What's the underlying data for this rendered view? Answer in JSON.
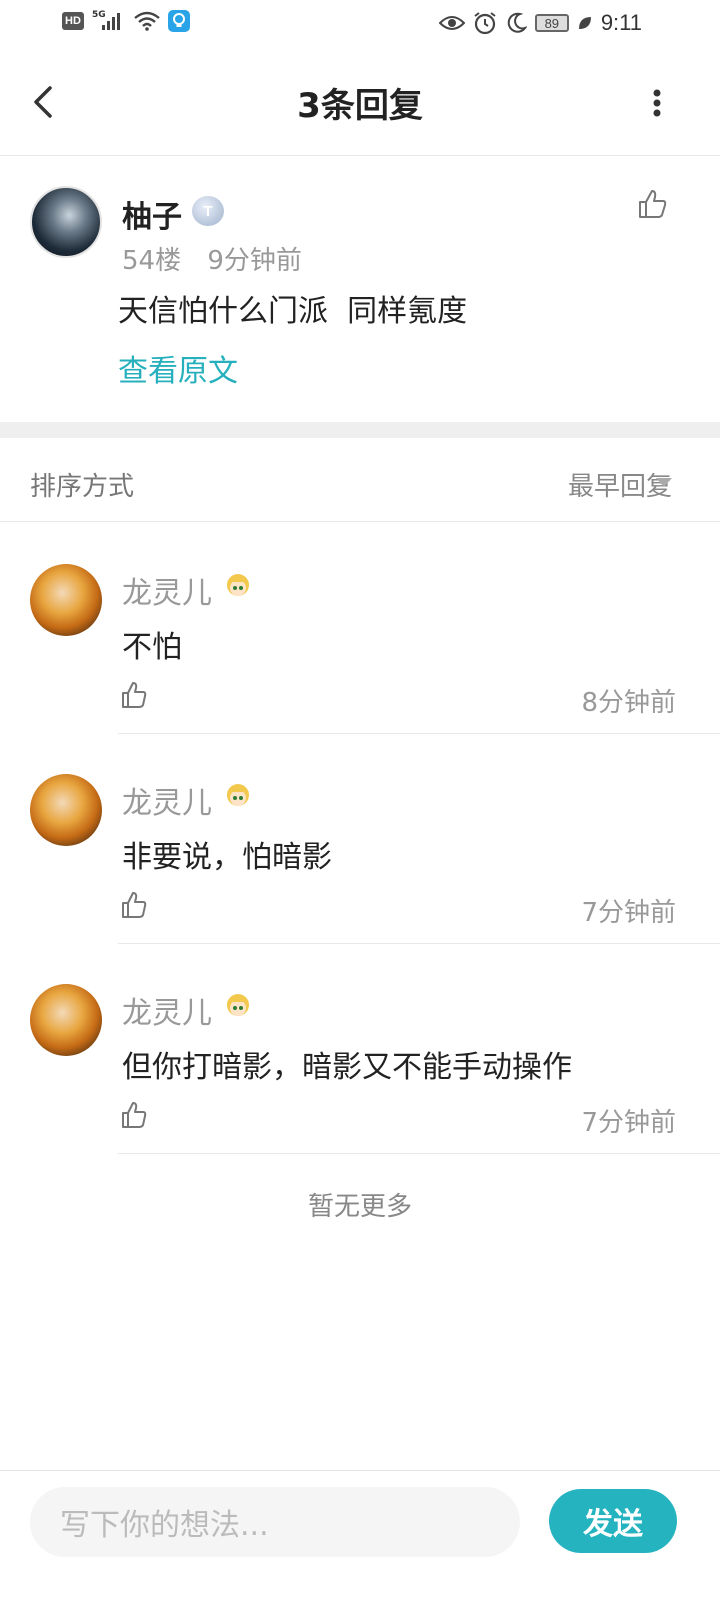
{
  "status_bar": {
    "network_label": "5G",
    "hd_label": "HD",
    "battery": "89",
    "time": "9:11"
  },
  "header": {
    "title": "3条回复"
  },
  "post": {
    "author": "柚子",
    "level_badge": "T",
    "floor": "54楼",
    "time": "9分钟前",
    "content": "天信怕什么门派  同样氪度",
    "view_original": "查看原文"
  },
  "sort": {
    "label": "排序方式",
    "value": "最早回复"
  },
  "replies": [
    {
      "author": "龙灵儿",
      "content": "不怕",
      "time": "8分钟前"
    },
    {
      "author": "龙灵儿",
      "content": "非要说，怕暗影",
      "time": "7分钟前"
    },
    {
      "author": "龙灵儿",
      "content": "但你打暗影，暗影又不能手动操作",
      "time": "7分钟前"
    }
  ],
  "no_more": "暂无更多",
  "composer": {
    "placeholder": "写下你的想法...",
    "send_label": "发送"
  },
  "colors": {
    "accent": "#26b3c0",
    "link": "#26b0bd",
    "muted": "#999999"
  }
}
